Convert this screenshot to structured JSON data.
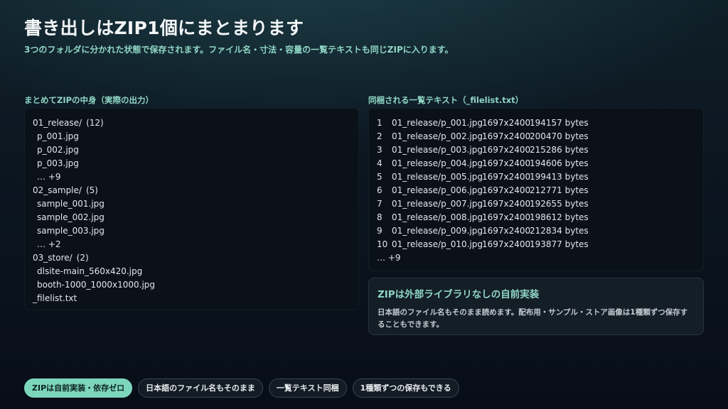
{
  "header": {
    "title": "書き出しはZIP1個にまとまります",
    "subtitle": "3つのフォルダに分かれた状態で保存されます。ファイル名・寸法・容量の一覧テキストも同じZIPに入ります。"
  },
  "left": {
    "label": "まとめてZIPの中身（実際の出力）",
    "tree": [
      {
        "type": "folder",
        "name": "01_release/",
        "count": "(12)"
      },
      {
        "type": "file",
        "name": "p_001.jpg"
      },
      {
        "type": "file",
        "name": "p_002.jpg"
      },
      {
        "type": "file",
        "name": "p_003.jpg"
      },
      {
        "type": "more",
        "name": "… +9"
      },
      {
        "type": "folder",
        "name": "02_sample/",
        "count": "(5)"
      },
      {
        "type": "file",
        "name": "sample_001.jpg"
      },
      {
        "type": "file",
        "name": "sample_002.jpg"
      },
      {
        "type": "file",
        "name": "sample_003.jpg"
      },
      {
        "type": "more",
        "name": "… +2"
      },
      {
        "type": "folder",
        "name": "03_store/",
        "count": "(2)"
      },
      {
        "type": "file",
        "name": "dlsite-main_560x420.jpg"
      },
      {
        "type": "file",
        "name": "booth-1000_1000x1000.jpg"
      },
      {
        "type": "root-file",
        "name": "_filelist.txt"
      }
    ]
  },
  "right": {
    "label": "同梱される一覧テキスト（_filelist.txt）",
    "rows": [
      {
        "num": "1",
        "path": "01_release/p_001.jpg",
        "dims": "1697x2400",
        "size": "194157 bytes"
      },
      {
        "num": "2",
        "path": "01_release/p_002.jpg",
        "dims": "1697x2400",
        "size": "200470 bytes"
      },
      {
        "num": "3",
        "path": "01_release/p_003.jpg",
        "dims": "1697x2400",
        "size": "215286 bytes"
      },
      {
        "num": "4",
        "path": "01_release/p_004.jpg",
        "dims": "1697x2400",
        "size": "194606 bytes"
      },
      {
        "num": "5",
        "path": "01_release/p_005.jpg",
        "dims": "1697x2400",
        "size": "199413 bytes"
      },
      {
        "num": "6",
        "path": "01_release/p_006.jpg",
        "dims": "1697x2400",
        "size": "212771 bytes"
      },
      {
        "num": "7",
        "path": "01_release/p_007.jpg",
        "dims": "1697x2400",
        "size": "192655 bytes"
      },
      {
        "num": "8",
        "path": "01_release/p_008.jpg",
        "dims": "1697x2400",
        "size": "198612 bytes"
      },
      {
        "num": "9",
        "path": "01_release/p_009.jpg",
        "dims": "1697x2400",
        "size": "212834 bytes"
      },
      {
        "num": "10",
        "path": "01_release/p_010.jpg",
        "dims": "1697x2400",
        "size": "193877 bytes"
      }
    ],
    "more": "… +9",
    "note": {
      "title": "ZIPは外部ライブラリなしの自前実装",
      "body": "日本語のファイル名もそのまま読めます。配布用・サンプル・ストア画像は1種類ずつ保存することもできます。"
    }
  },
  "chips": [
    {
      "label": "ZIPは自前実装・依存ゼロ",
      "active": true
    },
    {
      "label": "日本語のファイル名もそのまま",
      "active": false
    },
    {
      "label": "一覧テキスト同梱",
      "active": false
    },
    {
      "label": "1種類ずつの保存もできる",
      "active": false
    }
  ],
  "colors": {
    "accent": "#8fd6c4",
    "chip_active": "#7dd6bc",
    "panel": "#0a1119",
    "background": "#0b1520"
  }
}
